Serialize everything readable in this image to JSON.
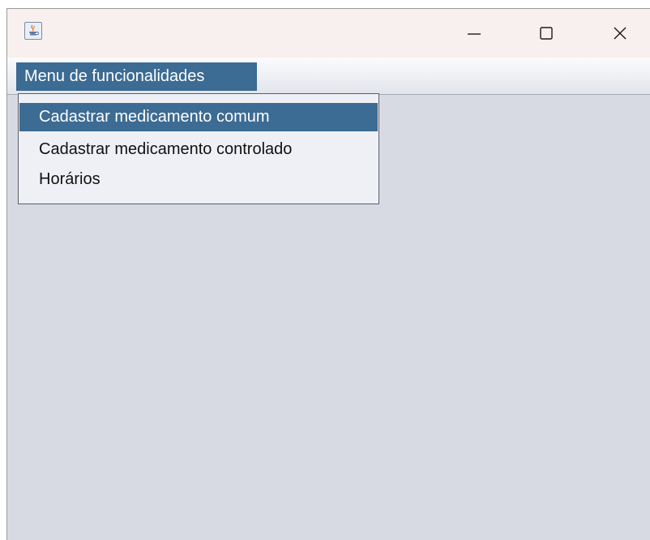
{
  "window": {
    "app_icon": "java-coffee-cup-icon",
    "controls": {
      "minimize_icon": "minimize-icon",
      "maximize_icon": "maximize-icon",
      "close_icon": "close-icon"
    }
  },
  "menubar": {
    "menu_label": "Menu de funcionalidades"
  },
  "dropdown": {
    "items": [
      {
        "label": "Cadastrar medicamento comum",
        "selected": true
      },
      {
        "label": "Cadastrar medicamento controlado",
        "selected": false
      },
      {
        "label": "Horários",
        "selected": false
      }
    ]
  },
  "colors": {
    "selection": "#3c6b93",
    "content_background": "#d7dae2",
    "titlebar_background": "#f8f0ee",
    "menu_background": "#eef0f5"
  }
}
